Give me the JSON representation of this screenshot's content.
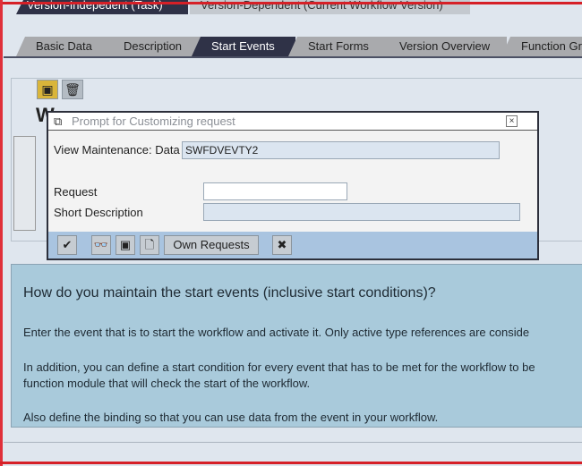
{
  "top_tabs": [
    {
      "label": "Version-Indepedent (Task)",
      "active": true
    },
    {
      "label": "Version-Dependent (Current Workflow Version)",
      "active": false
    }
  ],
  "sub_tabs": [
    {
      "label": "Basic Data"
    },
    {
      "label": "Description"
    },
    {
      "label": "Start Events",
      "active": true
    },
    {
      "label": "Start Forms"
    },
    {
      "label": "Version Overview"
    },
    {
      "label": "Function Gr"
    }
  ],
  "background": {
    "heading": "W"
  },
  "dialog": {
    "title": "Prompt for Customizing request",
    "view_label": "View Maintenance: Data",
    "view_value": "SWFDVEVTY2",
    "request_label": "Request",
    "request_value": "",
    "short_desc_label": "Short Description",
    "short_desc_value": "",
    "own_requests_label": "Own Requests"
  },
  "help": {
    "heading": "How do you maintain the start events (inclusive start conditions)?",
    "p1": "Enter the event that is to start the workflow and activate it. Only active type references are conside",
    "p2a": "In addition, you can define a start condition for every event that has to be met for the workflow to be",
    "p2b": "function module that will check the start of the workflow.",
    "p3": "Also define the binding so that you can use data from the event in your workflow."
  },
  "colors": {
    "active_tab": "#2f3247",
    "dialog_footer": "#a9c4e0",
    "help_bg": "#a9cadb",
    "frame_red": "#d62027"
  }
}
